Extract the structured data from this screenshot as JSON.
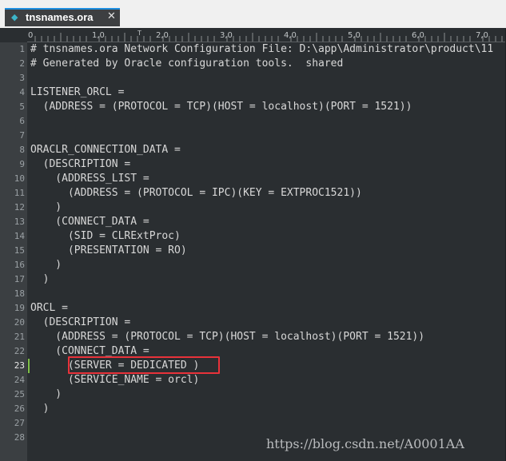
{
  "tab": {
    "label": "tnsnames.ora",
    "close": "✕"
  },
  "ruler": {
    "labels": [
      "0",
      "1,0",
      "2,0",
      "3,0",
      "4,0",
      "5,0",
      "6,0",
      "7,0"
    ],
    "tab_marker": "T"
  },
  "editor": {
    "active_line": 23,
    "lines": [
      {
        "n": "1",
        "text": "# tnsnames.ora Network Configuration File: D:\\app\\Administrator\\product\\11"
      },
      {
        "n": "2",
        "text": "# Generated by Oracle configuration tools.  shared"
      },
      {
        "n": "3",
        "text": ""
      },
      {
        "n": "4",
        "text": "LISTENER_ORCL ="
      },
      {
        "n": "5",
        "text": "  (ADDRESS = (PROTOCOL = TCP)(HOST = localhost)(PORT = 1521))"
      },
      {
        "n": "6",
        "text": ""
      },
      {
        "n": "7",
        "text": ""
      },
      {
        "n": "8",
        "text": "ORACLR_CONNECTION_DATA ="
      },
      {
        "n": "9",
        "text": "  (DESCRIPTION ="
      },
      {
        "n": "10",
        "text": "    (ADDRESS_LIST ="
      },
      {
        "n": "11",
        "text": "      (ADDRESS = (PROTOCOL = IPC)(KEY = EXTPROC1521))"
      },
      {
        "n": "12",
        "text": "    )"
      },
      {
        "n": "13",
        "text": "    (CONNECT_DATA ="
      },
      {
        "n": "14",
        "text": "      (SID = CLRExtProc)"
      },
      {
        "n": "15",
        "text": "      (PRESENTATION = RO)"
      },
      {
        "n": "16",
        "text": "    )"
      },
      {
        "n": "17",
        "text": "  )"
      },
      {
        "n": "18",
        "text": ""
      },
      {
        "n": "19",
        "text": "ORCL ="
      },
      {
        "n": "20",
        "text": "  (DESCRIPTION ="
      },
      {
        "n": "21",
        "text": "    (ADDRESS = (PROTOCOL = TCP)(HOST = localhost)(PORT = 1521))"
      },
      {
        "n": "22",
        "text": "    (CONNECT_DATA ="
      },
      {
        "n": "23",
        "text": "      (SERVER = DEDICATED )"
      },
      {
        "n": "24",
        "text": "      (SERVICE_NAME = orcl)"
      },
      {
        "n": "25",
        "text": "    )"
      },
      {
        "n": "26",
        "text": "  )"
      },
      {
        "n": "27",
        "text": ""
      },
      {
        "n": "28",
        "text": ""
      }
    ]
  },
  "watermark": "https://blog.csdn.net/A0001AA",
  "colors": {
    "accent": "#1f8fe0",
    "active_line": "#10566e",
    "highlight_box": "#e8323a",
    "background": "#2a2e31"
  }
}
